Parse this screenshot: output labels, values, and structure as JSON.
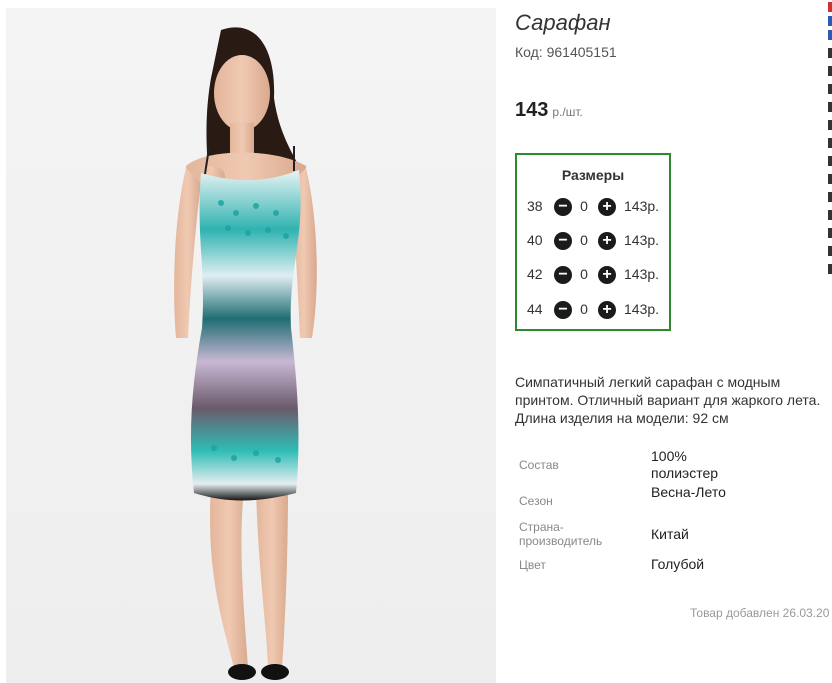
{
  "product": {
    "title": "Сарафан",
    "code": "Код: 961405151",
    "price": "143",
    "price_unit": "р./шт.",
    "image_name": "sundress-photo"
  },
  "sizes": {
    "title": "Размеры",
    "items": [
      {
        "size": "38",
        "qty": "0",
        "price": "143р."
      },
      {
        "size": "40",
        "qty": "0",
        "price": "143р."
      },
      {
        "size": "42",
        "qty": "0",
        "price": "143р."
      },
      {
        "size": "44",
        "qty": "0",
        "price": "143р."
      }
    ]
  },
  "description": "Симпатичный легкий сарафан с модным принтом. Отличный вариант для жаркого лета. Длина изделия на модели: 92 см",
  "attributes": [
    {
      "key": "Состав",
      "value": "100% полиэстер"
    },
    {
      "key": "Сезон",
      "value": "Весна-Лето"
    },
    {
      "key": "Страна-производитель",
      "value": "Китай"
    },
    {
      "key": "Цвет",
      "value": "Голубой"
    }
  ],
  "added": "Товар добавлен 26.03.20"
}
